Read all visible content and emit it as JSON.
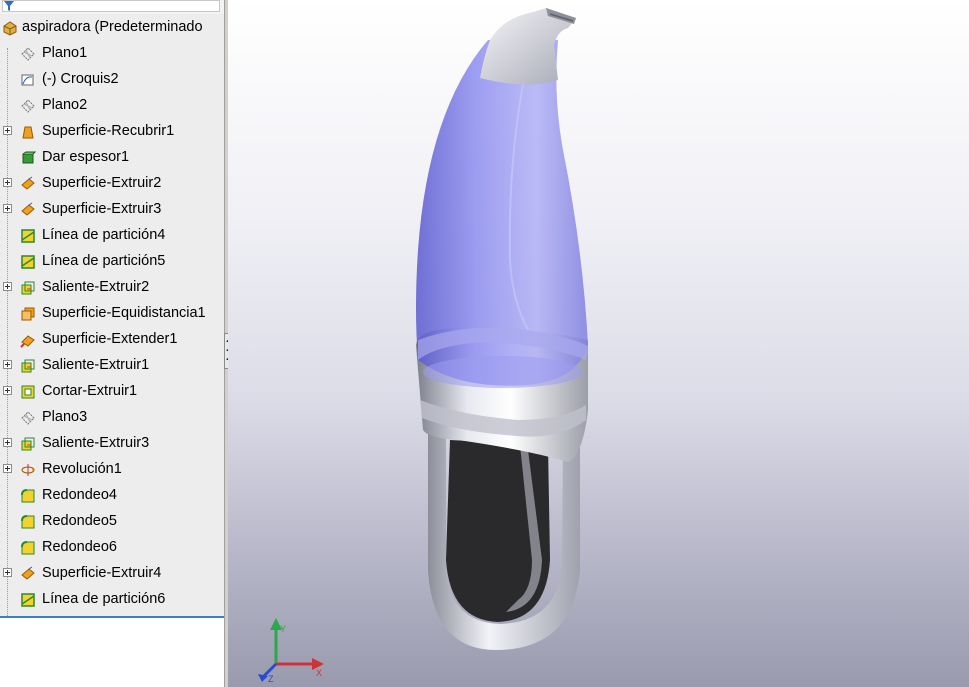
{
  "tree": {
    "root": {
      "label": "aspiradora  (Predeterminado",
      "icon": "part-icon"
    },
    "items": [
      {
        "label": "Plano1",
        "icon": "plane-icon",
        "expandable": false
      },
      {
        "label": "(-) Croquis2",
        "icon": "sketch-icon",
        "expandable": false
      },
      {
        "label": "Plano2",
        "icon": "plane-icon",
        "expandable": false
      },
      {
        "label": "Superficie-Recubrir1",
        "icon": "surface-loft-icon",
        "expandable": true
      },
      {
        "label": "Dar espesor1",
        "icon": "thicken-icon",
        "expandable": false
      },
      {
        "label": "Superficie-Extruir2",
        "icon": "surface-extrude-icon",
        "expandable": true
      },
      {
        "label": "Superficie-Extruir3",
        "icon": "surface-extrude-icon",
        "expandable": true
      },
      {
        "label": "Línea de partición4",
        "icon": "split-line-icon",
        "expandable": false
      },
      {
        "label": "Línea de partición5",
        "icon": "split-line-icon",
        "expandable": false
      },
      {
        "label": "Saliente-Extruir2",
        "icon": "boss-extrude-icon",
        "expandable": true
      },
      {
        "label": "Superficie-Equidistancia1",
        "icon": "surface-offset-icon",
        "expandable": false
      },
      {
        "label": "Superficie-Extender1",
        "icon": "surface-extend-icon",
        "expandable": false
      },
      {
        "label": "Saliente-Extruir1",
        "icon": "boss-extrude-icon",
        "expandable": true
      },
      {
        "label": "Cortar-Extruir1",
        "icon": "cut-extrude-icon",
        "expandable": true
      },
      {
        "label": "Plano3",
        "icon": "plane-icon",
        "expandable": false
      },
      {
        "label": "Saliente-Extruir3",
        "icon": "boss-extrude-icon",
        "expandable": true
      },
      {
        "label": "Revolución1",
        "icon": "revolve-icon",
        "expandable": true
      },
      {
        "label": "Redondeo4",
        "icon": "fillet-icon",
        "expandable": false
      },
      {
        "label": "Redondeo5",
        "icon": "fillet-icon",
        "expandable": false
      },
      {
        "label": "Redondeo6",
        "icon": "fillet-icon",
        "expandable": false
      },
      {
        "label": "Superficie-Extruir4",
        "icon": "surface-extrude-icon",
        "expandable": true
      },
      {
        "label": "Línea de partición6",
        "icon": "split-line-icon",
        "expandable": false
      }
    ]
  },
  "viewport": {
    "model": "vacuum-cleaner-3d-model",
    "triad_axes": [
      "X",
      "Y",
      "Z"
    ]
  },
  "colors": {
    "accent": "#3a7fc0",
    "tree_bg": "#ededed",
    "transparent_shell": "#7a7ae6"
  }
}
